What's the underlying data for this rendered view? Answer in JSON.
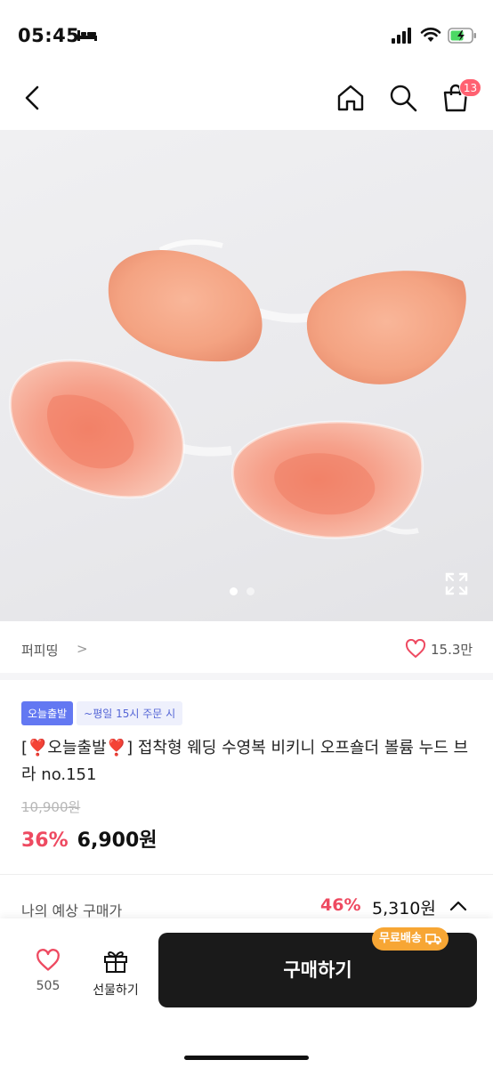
{
  "status_bar": {
    "time": "05:45"
  },
  "nav": {
    "cart_count": "13"
  },
  "seller": {
    "name": "퍼피띵",
    "chevron": ">",
    "like_count": "15.3만"
  },
  "product": {
    "badge_today": "오늘출발",
    "badge_cutoff": "~평일 15시 주문 시",
    "title": "[❣️오늘출발❣️] 접착형 웨딩 수영복 비키니 오프숄더 볼륨 누드 브라 no.151",
    "original_price": "10,900원",
    "discount": "36%",
    "sale_price": "6,900원"
  },
  "expected": {
    "label": "나의 예상 구매가",
    "discount": "46%",
    "price": "5,310원"
  },
  "bottom_bar": {
    "like_count": "505",
    "gift_label": "선물하기",
    "buy_label": "구매하기",
    "free_shipping": "무료배송"
  },
  "colors": {
    "accent_red": "#ee4a61",
    "badge_blue": "#6378f2",
    "free_ship_orange": "#f7a634"
  }
}
